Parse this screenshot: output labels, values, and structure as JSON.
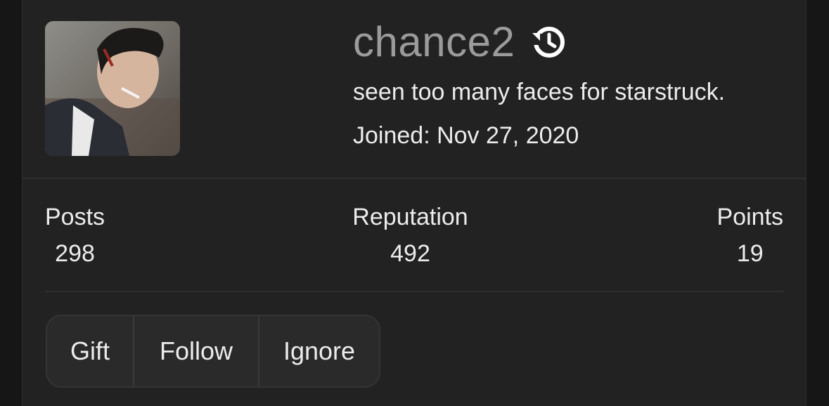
{
  "profile": {
    "username": "chance2",
    "tagline": "seen too many faces for starstruck.",
    "joined": "Joined: Nov 27, 2020",
    "icons": {
      "avatar": "avatar-photo",
      "history": "history-icon"
    }
  },
  "stats": [
    {
      "label": "Posts",
      "value": "298"
    },
    {
      "label": "Reputation",
      "value": "492"
    },
    {
      "label": "Points",
      "value": "19"
    }
  ],
  "actions": {
    "gift": "Gift",
    "follow": "Follow",
    "ignore": "Ignore"
  },
  "colors": {
    "background": "#161616",
    "card": "#222222",
    "username": "#9b9b9b",
    "text": "#ececec",
    "button_bg": "#2a2a2a"
  }
}
